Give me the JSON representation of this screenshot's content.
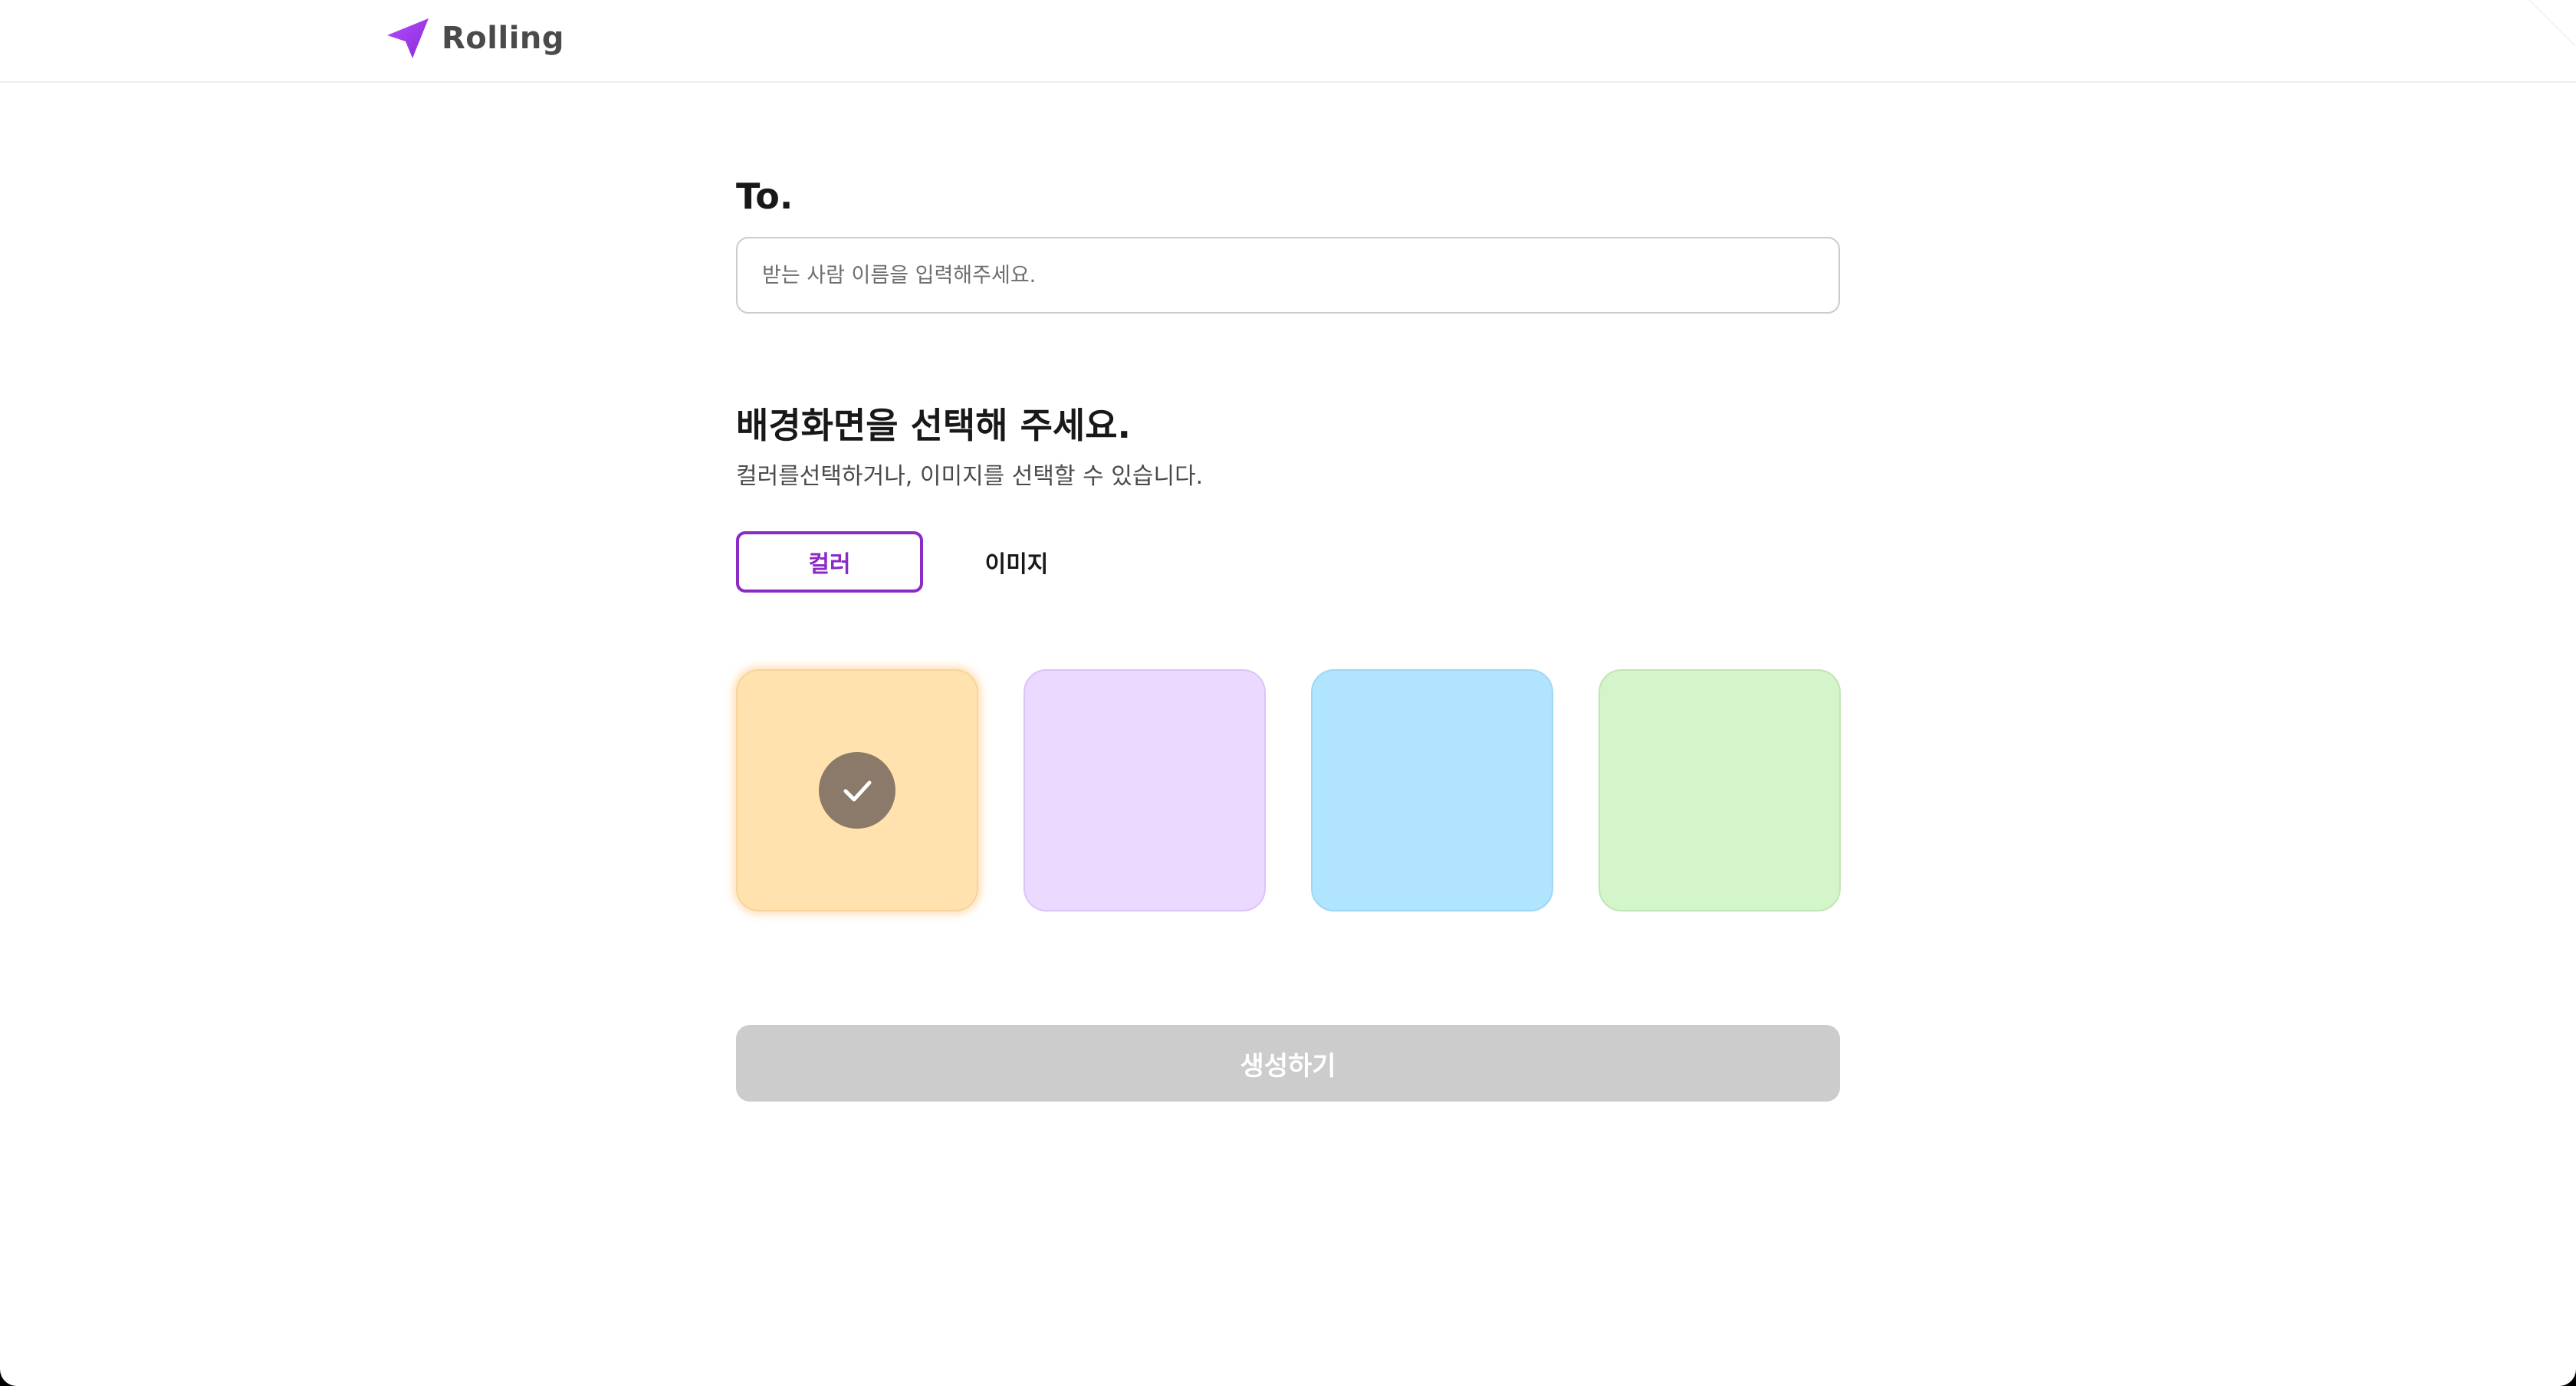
{
  "header": {
    "logo_text": "Rolling",
    "logo_icon": "paper-plane-icon",
    "accent": "#9935ff"
  },
  "form": {
    "to_label": "To.",
    "to_input": {
      "placeholder": "받는 사람 이름을 입력해주세요.",
      "value": ""
    },
    "background_title": "배경화면을 선택해 주세요.",
    "background_description": "컬러를선택하거나, 이미지를 선택할 수 있습니다.",
    "tabs": [
      {
        "label": "컬러",
        "selected": true
      },
      {
        "label": "이미지",
        "selected": false
      }
    ],
    "swatches": [
      {
        "name": "beige",
        "color": "#ffe2ad",
        "selected": true
      },
      {
        "name": "purple",
        "color": "#ecd9ff",
        "selected": false
      },
      {
        "name": "blue",
        "color": "#b1e4ff",
        "selected": false
      },
      {
        "name": "green",
        "color": "#d4f4c9",
        "selected": false
      }
    ],
    "selected_check_icon": "check-icon",
    "create_button": {
      "label": "생성하기",
      "disabled": true
    }
  },
  "colors": {
    "selected_tab_border": "#8a2bc6",
    "disabled_button": "#cccccc",
    "check_badge": "#8b7a6a"
  }
}
